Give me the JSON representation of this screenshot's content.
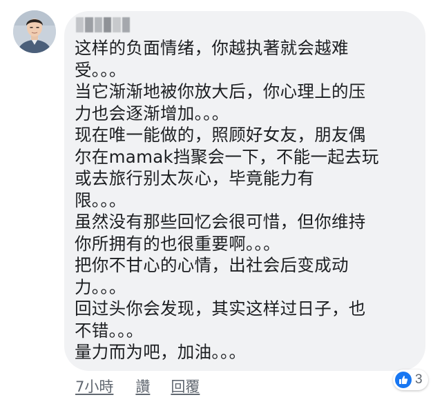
{
  "comment": {
    "author_name": "",
    "lines": [
      "这样的负面情绪，你越执著就会越难",
      "受。。。",
      "当它渐渐地被你放大后，你心理上的压",
      "力也会逐渐增加。。。",
      "现在唯一能做的，照顾好女友，朋友偶",
      "尔在mamak挡聚会一下，不能一起去玩",
      "或去旅行别太灰心，毕竟能力有",
      "限。。。",
      "虽然没有那些回忆会很可惜，但你维持",
      "你所拥有的也很重要啊。。。",
      "把你不甘心的心情，出社会后变成动",
      "力。。。",
      "回过头你会发现，其实这样过日子，也",
      "不错。。。",
      "量力而为吧，加油。。。"
    ]
  },
  "actions": {
    "time": "7小時",
    "like": "讚",
    "reply": "回覆"
  },
  "reactions": {
    "icon": "thumbs-up-icon",
    "count": "3",
    "color": "#1877f2"
  },
  "colors": {
    "bubble": "#f1f2f4",
    "text": "#1c1e21",
    "meta": "#606770"
  }
}
